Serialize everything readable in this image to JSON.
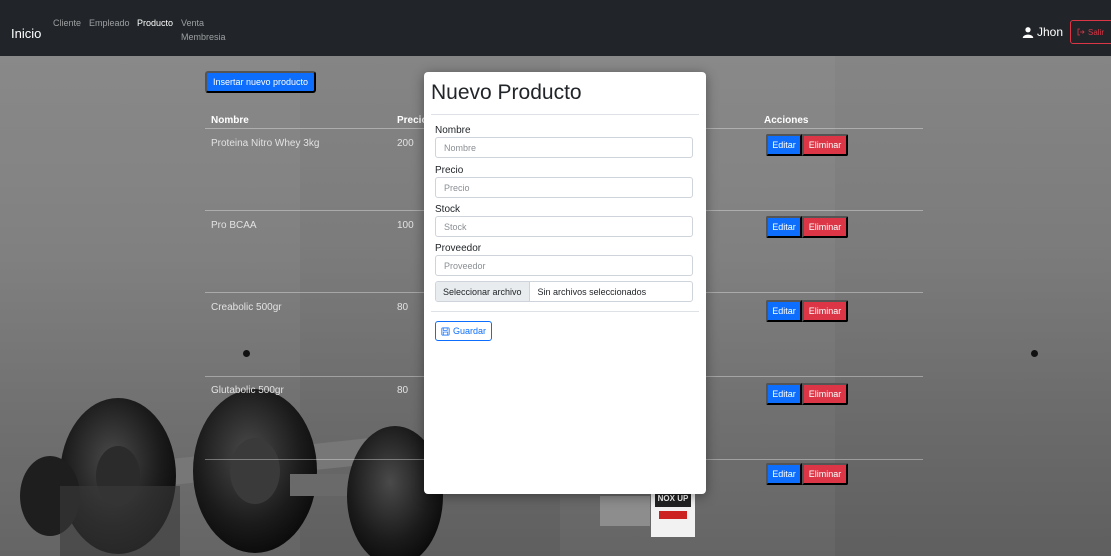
{
  "navbar": {
    "brand": "Inicio",
    "links": [
      {
        "label": "Cliente",
        "active": false
      },
      {
        "label": "Empleado",
        "active": false
      },
      {
        "label": "Producto",
        "active": true
      },
      {
        "label": "Venta",
        "active": false
      },
      {
        "label": "Membresia",
        "active": false
      }
    ],
    "user_name": "Jhon",
    "logout_label": "Salir"
  },
  "page": {
    "insert_button": "Insertar nuevo producto",
    "table": {
      "headers": [
        "Nombre",
        "Precio",
        "Acciones"
      ],
      "rows": [
        {
          "nombre": "Proteina Nitro Whey 3kg",
          "precio": "200"
        },
        {
          "nombre": "Pro BCAA",
          "precio": "100"
        },
        {
          "nombre": "Creabolic 500gr",
          "precio": "80"
        },
        {
          "nombre": "Glutabolic 500gr",
          "precio": "80"
        },
        {
          "nombre": "",
          "precio": ""
        }
      ],
      "edit_label": "Editar",
      "delete_label": "Eliminar"
    },
    "thumbnail_text": "NOX UP"
  },
  "modal": {
    "title": "Nuevo Producto",
    "fields": [
      {
        "label": "Nombre",
        "placeholder": "Nombre",
        "value": ""
      },
      {
        "label": "Precio",
        "placeholder": "Precio",
        "value": ""
      },
      {
        "label": "Stock",
        "placeholder": "Stock",
        "value": ""
      },
      {
        "label": "Proveedor",
        "placeholder": "Proveedor",
        "value": ""
      }
    ],
    "file": {
      "button_label": "Seleccionar archivo",
      "status": "Sin archivos seleccionados"
    },
    "save_label": "Guardar"
  },
  "colors": {
    "navbar": "#212529",
    "primary": "#0d6efd",
    "danger": "#dc3545"
  },
  "icons": {
    "user": "user-icon",
    "logout": "sign-out-icon",
    "save": "floppy-disk-icon"
  }
}
